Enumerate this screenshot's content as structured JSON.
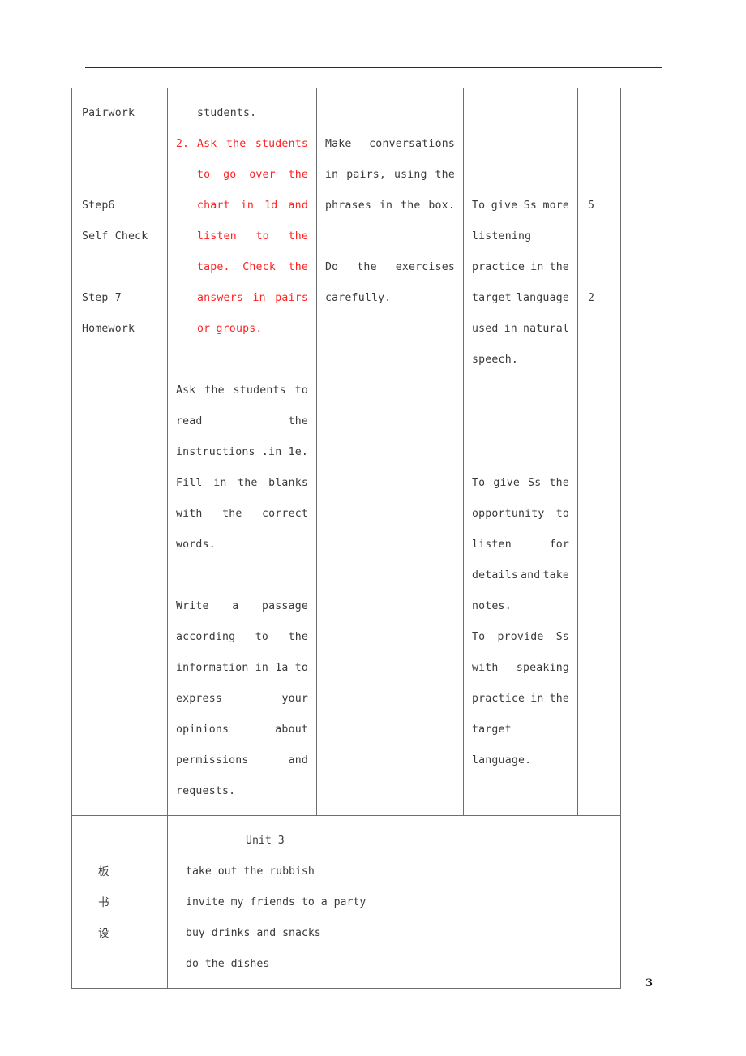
{
  "page": {
    "number": "3"
  },
  "table": {
    "col1": {
      "lines": [
        "Pairwork",
        "",
        "",
        "Step6",
        "Self Check",
        "",
        "Step 7",
        "Homework"
      ]
    },
    "col2": {
      "first_line": "students.",
      "numbered_marker": "2.",
      "numbered_item_lines": [
        [
          "Ask",
          "the",
          "students"
        ],
        [
          "to",
          "go",
          "over",
          "the"
        ],
        [
          "chart",
          "in",
          "1d",
          "and"
        ],
        [
          "listen",
          "to",
          "the"
        ],
        [
          "tape.",
          "Check",
          "the"
        ],
        [
          "answers",
          "in",
          "pairs"
        ],
        [
          "or",
          "groups."
        ]
      ],
      "para2_lines": [
        [
          "Ask",
          "the",
          "students",
          "to"
        ],
        [
          "read",
          "the"
        ],
        [
          "instructions",
          ".in",
          "1e."
        ],
        [
          "Fill",
          "in",
          "the",
          "blanks"
        ],
        [
          "with",
          "the",
          "correct"
        ],
        [
          "words."
        ]
      ],
      "para3_lines": [
        [
          "Write",
          "a",
          "passage"
        ],
        [
          "according",
          "to",
          "the"
        ],
        [
          "information",
          "in",
          "1a",
          "to"
        ],
        [
          "express",
          "your"
        ],
        [
          "opinions",
          "about"
        ],
        [
          "permissions",
          "and"
        ],
        [
          "requests."
        ]
      ]
    },
    "col3": {
      "para1_lines": [
        [
          "Make",
          "conversations"
        ],
        [
          "in",
          "pairs,",
          "using",
          "the"
        ],
        [
          "phrases",
          "in",
          "the",
          "box."
        ]
      ],
      "para2_lines": [
        [
          "Do",
          "the",
          "exercises"
        ],
        [
          "carefully."
        ]
      ]
    },
    "col4": {
      "para1_lines": [
        [
          "To",
          "give",
          "Ss",
          "more"
        ],
        [
          "listening"
        ],
        [
          "practice",
          "in",
          "the"
        ],
        [
          "target",
          "language"
        ],
        [
          "used",
          "in",
          "natural"
        ],
        [
          "speech."
        ]
      ],
      "para2_lines": [
        [
          "To",
          "give",
          "Ss",
          "the"
        ],
        [
          "opportunity",
          "to"
        ],
        [
          "listen",
          "for"
        ],
        [
          "details",
          "and",
          "take"
        ],
        [
          "notes."
        ]
      ],
      "para3_lines": [
        [
          "To",
          "provide",
          "Ss"
        ],
        [
          "with",
          "speaking"
        ],
        [
          "practice",
          "in",
          "the"
        ],
        [
          "target"
        ],
        [
          "language."
        ]
      ]
    },
    "col5": {
      "values": [
        "5",
        "2"
      ]
    },
    "bottom": {
      "label_chars": [
        "板",
        "书",
        "设"
      ],
      "unit_title": "Unit 3",
      "board_lines": [
        "take out the rubbish",
        "invite my friends to a party",
        "buy drinks and snacks",
        "do the dishes"
      ]
    }
  }
}
